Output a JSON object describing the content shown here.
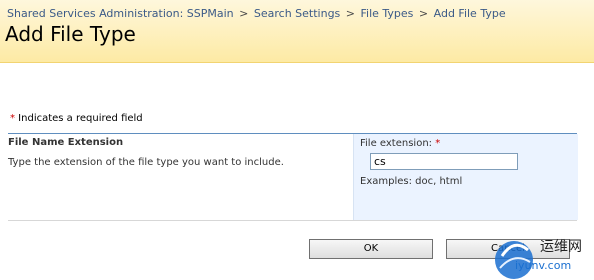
{
  "breadcrumb": {
    "items": [
      "Shared Services Administration: SSPMain",
      "Search Settings",
      "File Types"
    ],
    "separator": ">",
    "current": "Add File Type"
  },
  "page": {
    "title": "Add File Type",
    "required_note_star": "*",
    "required_note": " Indicates a required field"
  },
  "section": {
    "title": "File Name Extension",
    "description": "Type the extension of the file type you want to include.",
    "field_label": "File extension: ",
    "field_required_star": "*",
    "field_value": "cs",
    "examples": "Examples: doc, html"
  },
  "buttons": {
    "ok": "OK",
    "cancel": "Cancel"
  },
  "watermark": {
    "line1": "运维网",
    "line2": "iyunv.com"
  },
  "colors": {
    "header_top": "#fef7dc",
    "header_bottom": "#fdeaa4",
    "breadcrumb_link": "#3b5a87",
    "required_star": "#cc0000",
    "panel_background": "#ebf3ff",
    "section_line": "#5f8ebf"
  }
}
